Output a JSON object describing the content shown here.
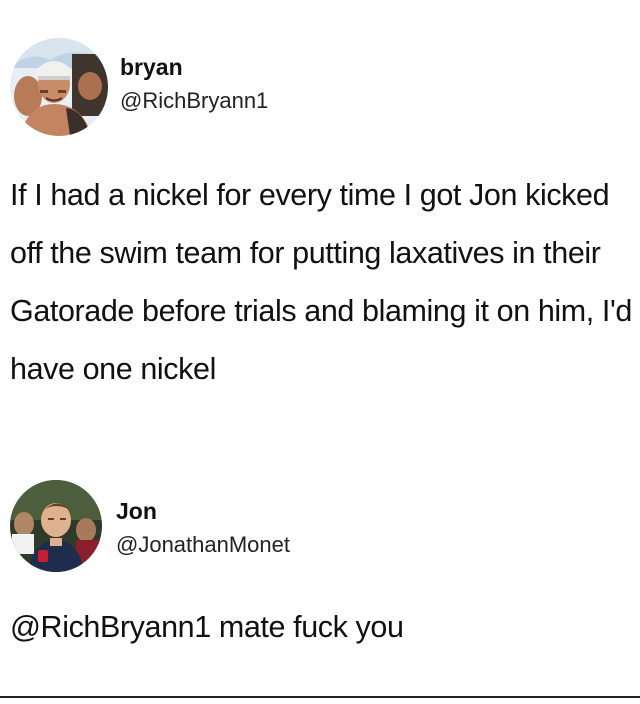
{
  "tweets": [
    {
      "display_name": "bryan",
      "handle": "@RichBryann1",
      "text": "If I had a nickel for every time I got Jon kicked off the swim team for putting laxatives in their Gatorade before trials and blaming it on him, I'd have one nickel",
      "avatar_icon": "profile-photo"
    },
    {
      "display_name": "Jon",
      "handle": "@JonathanMonet",
      "text": "@RichBryann1 mate fuck you",
      "avatar_icon": "profile-photo"
    }
  ],
  "colors": {
    "background": "#ffffff",
    "text": "#111111"
  }
}
